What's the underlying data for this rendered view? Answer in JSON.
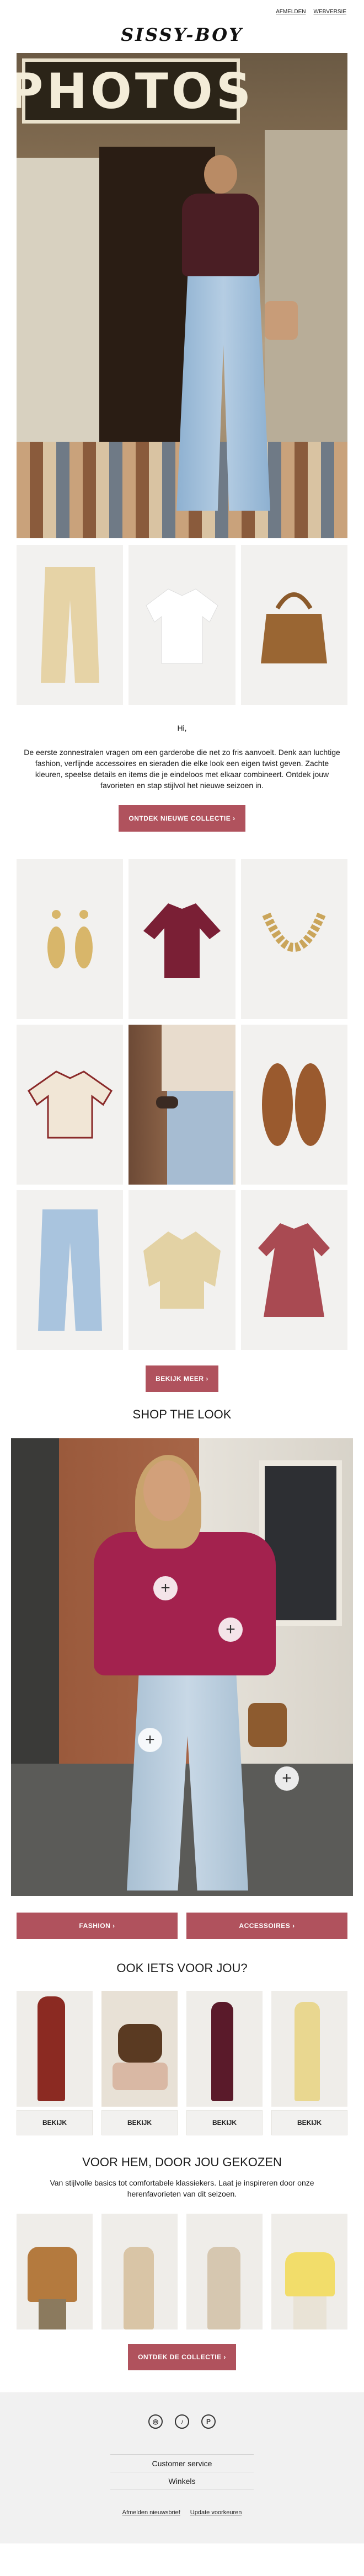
{
  "top_links": {
    "link1": "AFMELDEN",
    "link2": "WEBVERSIE"
  },
  "brand": {
    "logo_text": "SISSY-BOY",
    "accent": "#b0525d"
  },
  "hero": {
    "sign_text": "PHOTOS"
  },
  "intro": {
    "greeting": "Hi,",
    "body": "De eerste zonnestralen vragen om een garderobe die net zo fris aanvoelt. Denk aan luchtige fashion, verfijnde accessoires en sieraden die elke look een eigen twist geven. Zachte kleuren, speelse details en items die je eindeloos met elkaar combineert. Ontdek jouw favorieten en stap stijlvol het nieuwe seizoen in.",
    "cta": "ONTDEK NIEUWE COLLECTIE ›"
  },
  "grid": {
    "cta": "BEKIJK MEER ›"
  },
  "shop_the_look": {
    "title": "SHOP THE LOOK",
    "btn_fashion": "FASHION ›",
    "btn_accessoires": "ACCESSOIRES ›"
  },
  "also_for_you": {
    "title": "OOK IETS VOOR JOU?",
    "items": [
      "BEKIJK",
      "BEKIJK",
      "BEKIJK",
      "BEKIJK"
    ]
  },
  "men": {
    "title": "VOOR HEM, DOOR JOU GEKOZEN",
    "body": "Van stijlvolle basics tot comfortabele klassiekers. Laat je inspireren door onze herenfavorieten van dit seizoen.",
    "cta": "ONTDEK DE COLLECTIE ›"
  },
  "footer": {
    "social": [
      "instagram-icon",
      "tiktok-icon",
      "pinterest-icon"
    ],
    "links": [
      "Customer service",
      "Winkels"
    ],
    "bottom_left": "Afmelden nieuwsbrief",
    "bottom_right": "Update voorkeuren"
  }
}
